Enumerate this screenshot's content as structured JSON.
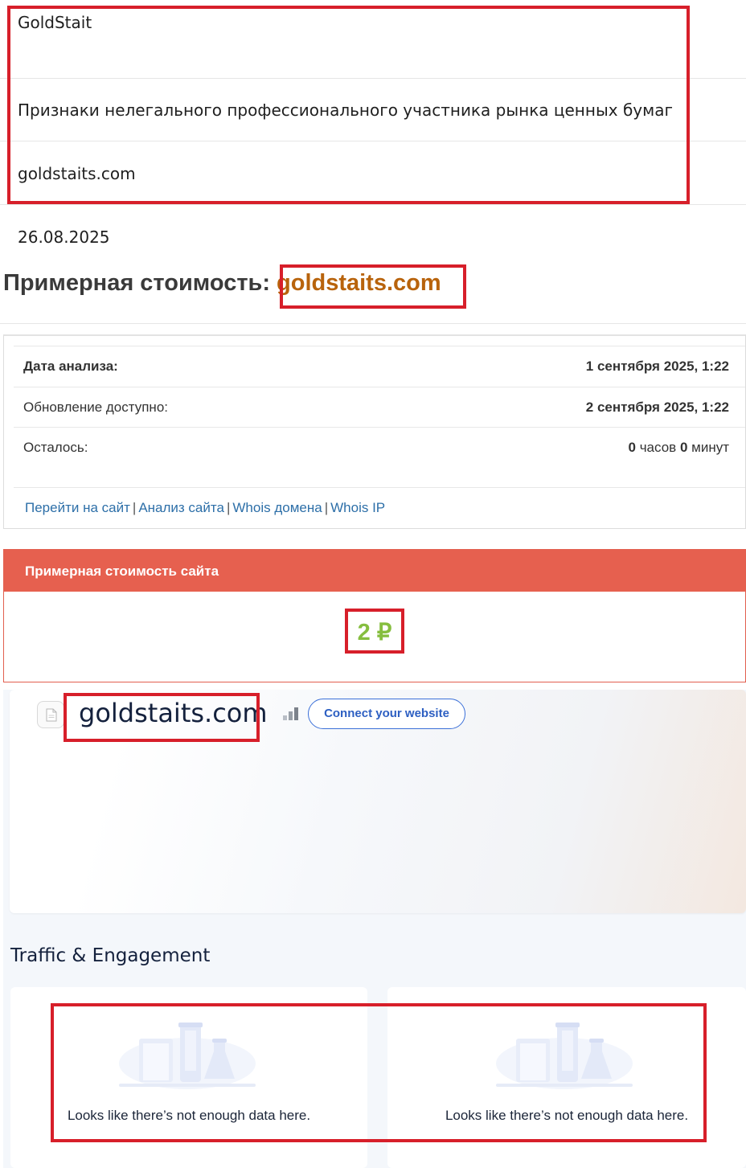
{
  "info": {
    "name": "GoldStait",
    "description": "Признаки нелегального профессионального участника рынка ценных бумаг",
    "site": "goldstaits.com",
    "date": "26.08.2025"
  },
  "heading": {
    "label": "Примерная стоимость:",
    "domain": "goldstaits.com"
  },
  "analysis": {
    "rows": [
      {
        "label": "Дата анализа:",
        "value": "1 сентября 2025, 1:22"
      },
      {
        "label": "Обновление доступно:",
        "value": "2 сентября 2025, 1:22"
      }
    ],
    "remaining": {
      "label": "Осталось:",
      "hours_num": "0",
      "hours_unit": "часов",
      "minutes_num": "0",
      "minutes_unit": "минут"
    },
    "links": {
      "go_to_site": "Перейти на сайт",
      "site_analysis": "Анализ сайта",
      "whois_domain": "Whois домена",
      "whois_ip": "Whois IP",
      "separator": "|"
    }
  },
  "estimated_value": {
    "header": "Примерная стоимость сайта",
    "amount": "2 ₽",
    "amount_color": "#86be3f",
    "header_color": "#e6604f"
  },
  "similarweb": {
    "domain": "goldstaits.com",
    "connect_button": "Connect your website",
    "section_title": "Traffic & Engagement",
    "cards": [
      {
        "message": "Looks like there’s not enough data here."
      },
      {
        "message": "Looks like there’s not enough data here."
      }
    ],
    "icons": {
      "favicon": "page-icon",
      "rank": "rank-bars-icon",
      "empty": "lab-flasks-icon"
    }
  },
  "highlight_color": "#d71f2a"
}
